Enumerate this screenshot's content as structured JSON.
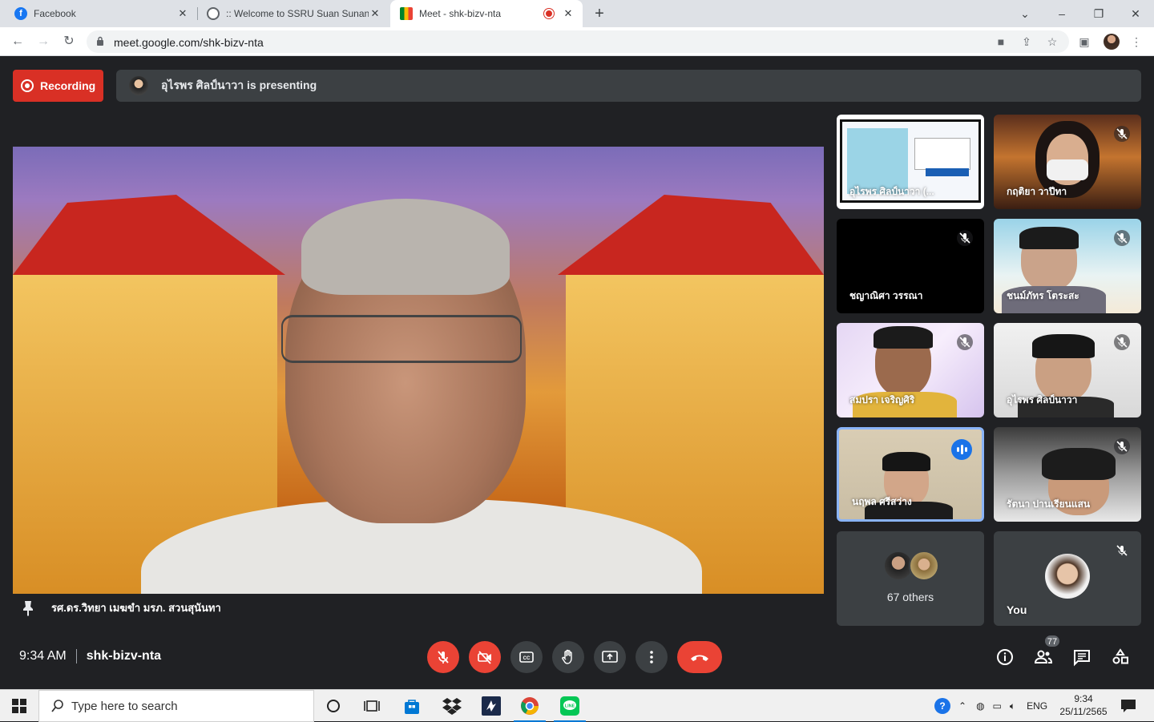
{
  "browser": {
    "tabs": [
      {
        "title": "Facebook",
        "icon": "facebook-icon"
      },
      {
        "title": ":: Welcome to SSRU Suan Sunandha",
        "icon": "globe-icon"
      },
      {
        "title": "Meet - shk-bizv-nta",
        "icon": "meet-icon"
      }
    ],
    "url": "meet.google.com/shk-bizv-nta"
  },
  "meet": {
    "recording_label": "Recording",
    "presenting_text": "อุไรพร ศิลป์นาวา is presenting",
    "pinned_name": "รศ.ดร.วิทยา เมฆขำ มรภ. สวนสุนันทา",
    "tiles": [
      {
        "name": "อุไรพร ศิลป์นาวา (...",
        "muted": true,
        "kind": "screen"
      },
      {
        "name": "กฤติยา วาปีทา",
        "muted": true,
        "kind": "video"
      },
      {
        "name": "ชญาณิศา วรรณา",
        "muted": true,
        "kind": "black"
      },
      {
        "name": "ชนม์ภัทร โตระสะ",
        "muted": true,
        "kind": "video"
      },
      {
        "name": "สมปรา เจริญศิริ",
        "muted": true,
        "kind": "video"
      },
      {
        "name": "อุไรพร ศิลป์นาวา",
        "muted": true,
        "kind": "video"
      },
      {
        "name": "นฤพล ศรีสว่าง",
        "muted": false,
        "kind": "video"
      },
      {
        "name": "รัตนา ปานเรียนแสน",
        "muted": true,
        "kind": "video"
      }
    ],
    "others_label": "67 others",
    "you_label": "You",
    "time": "9:34 AM",
    "meeting_code": "shk-bizv-nta",
    "participants_count": "77"
  },
  "taskbar": {
    "search_placeholder": "Type here to search",
    "language": "ENG",
    "clock_time": "9:34",
    "clock_date": "25/11/2565"
  },
  "colors": {
    "meet_bg": "#202124",
    "tile_bg": "#3c4043",
    "recording": "#d93025",
    "end_call": "#ea4335",
    "active_speaker": "#8ab4f8"
  }
}
